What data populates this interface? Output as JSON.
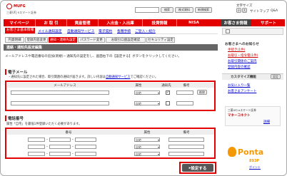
{
  "header": {
    "brand": "MUFG",
    "sub": "三菱UFJ eスマート証券",
    "search_placeholder": "",
    "search_button": "検索",
    "stock_code": "株式資料",
    "new_window": "新規検索",
    "font_size_label": "文字サイズ",
    "font_small": "小",
    "font_large": "大",
    "sitemap": "サイトマップ",
    "qa": "Q&A"
  },
  "nav": {
    "tabs": [
      "マイページ",
      "お 取 引",
      "資産管理",
      "入出金・入出庫",
      "投資情報",
      "NISA"
    ],
    "right_tab": "お客さま情報",
    "support": "サポート"
  },
  "subnav": [
    "お客さま基本情報",
    "メイル通知設定",
    "自動通知サービス",
    "電子契約",
    "各種手続",
    "ご登入・紹介"
  ],
  "tabs2": [
    "円貨明細",
    "登録内容変更",
    "通知・連絡先設定",
    "パスワード変更",
    "お取引口座設定確認",
    "セキュリティ設定"
  ],
  "section_bar": "連絡・通知先設定編集",
  "intro": "メールアドレスや電話番号の追加(新規)・通知先の設定をし、画面右下の【設定する】ボタンをクリックしてください。",
  "email": {
    "title": "電子メール",
    "note1": "・通知先に設定された場合、取引関連の通知が届きます。詳しい内容は",
    "note_link": "自動通知サービス",
    "note2": "でご確認ください。",
    "headers": [
      "メールアドレス",
      "属性",
      "通知先",
      "備考"
    ],
    "rows": [
      {
        "value": "",
        "attr": "自宅",
        "checked": true,
        "del": "削除"
      },
      {
        "value": "",
        "attr": "自宅",
        "checked": false,
        "del": ""
      }
    ]
  },
  "phone": {
    "title": "電話番号",
    "note": "属性「自宅」を最低1件登録いただく必要があります。",
    "headers": [
      "番号",
      "属性",
      "備考"
    ],
    "rows": [
      {
        "attr": "自宅"
      },
      {
        "attr": "自宅"
      },
      {
        "attr": "自宅"
      }
    ]
  },
  "submit": "設定する",
  "right": {
    "notice_title": "お客さまへのお知らせ",
    "notices": [
      "手続き(1件)",
      "お取引・指令電(1件)",
      "お取引関係のご案内",
      "登録内容の確認"
    ],
    "customize": "カスタマイズ機能",
    "customize_btn": "設定",
    "links": [
      "お気に入り一覧",
      "お客さまアンケート"
    ],
    "stock_box": "三菱UFJ eスマート証券",
    "stock_sub": "マネーコネクト",
    "stock_detail": "詳細",
    "ponta": "Ponta",
    "ponta_sub": "893P",
    "ponta_link": "ポイント"
  },
  "colors": {
    "nav": "#e20000",
    "accent": "#c00000",
    "ponta": "#f39800"
  }
}
